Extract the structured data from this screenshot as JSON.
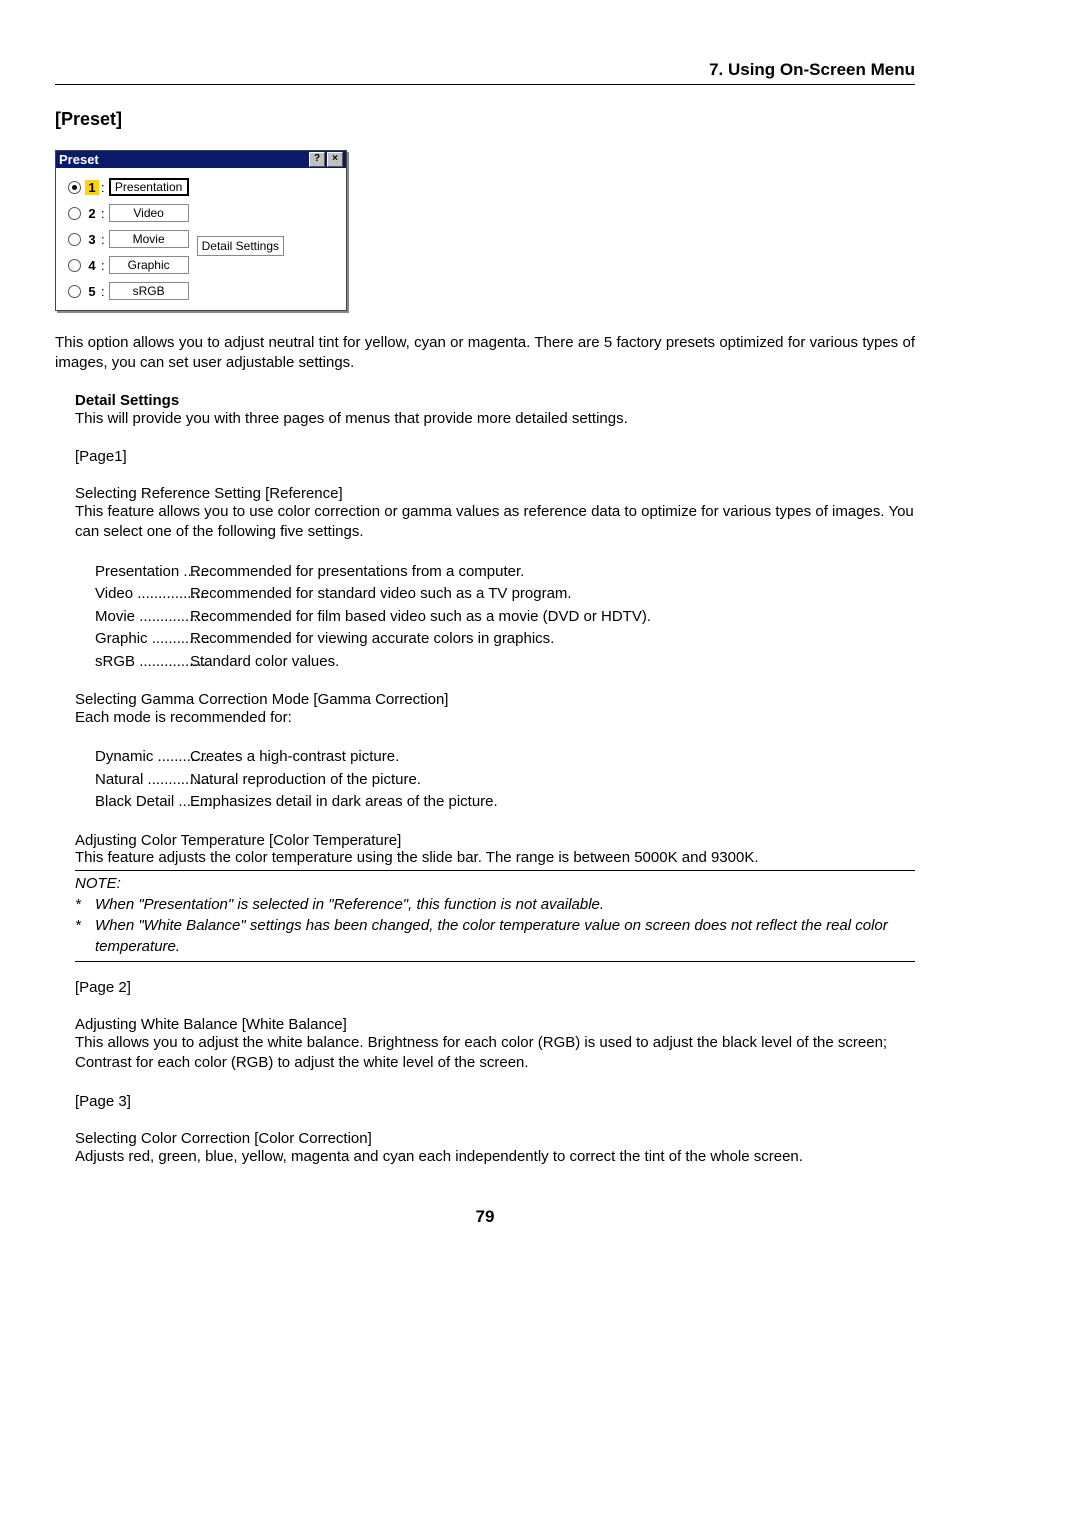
{
  "header": "7. Using On-Screen Menu",
  "section_title": "[Preset]",
  "dialog": {
    "title": "Preset",
    "detail_btn": "Detail Settings",
    "rows": [
      {
        "num": "1",
        "label": "Presentation",
        "checked": true
      },
      {
        "num": "2",
        "label": "Video",
        "checked": false
      },
      {
        "num": "3",
        "label": "Movie",
        "checked": false
      },
      {
        "num": "4",
        "label": "Graphic",
        "checked": false
      },
      {
        "num": "5",
        "label": "sRGB",
        "checked": false
      }
    ]
  },
  "intro": "This option allows you to adjust neutral tint for yellow, cyan or magenta. There are 5 factory presets optimized for various types of images, you can set user adjustable settings.",
  "detail_heading": "Detail Settings",
  "detail_desc": "This will provide you with three pages of menus that provide more detailed settings.",
  "page1_label": "[Page1]",
  "ref_title": "Selecting Reference Setting [Reference]",
  "ref_desc": "This feature allows you to use color correction or gamma values as reference data to optimize for various types of images. You can select one of the following five settings.",
  "ref_list": [
    {
      "term": "Presentation",
      "sep": "......",
      "desc": "Recommended for presentations from a computer."
    },
    {
      "term": "Video",
      "sep": ".................",
      "desc": "Recommended for standard video such as a TV program."
    },
    {
      "term": "Movie",
      "sep": "................",
      "desc": "Recommended for film based video such as a movie (DVD or HDTV)."
    },
    {
      "term": "Graphic",
      "sep": "..............",
      "desc": "Recommended for viewing accurate colors in graphics."
    },
    {
      "term": "sRGB",
      "sep": ".................",
      "desc": "Standard color values."
    }
  ],
  "gamma_title": "Selecting Gamma Correction Mode [Gamma Correction]",
  "gamma_desc": "Each mode is recommended for:",
  "gamma_list": [
    {
      "term": "Dynamic",
      "sep": "............",
      "desc": "Creates a high-contrast picture."
    },
    {
      "term": "Natural",
      "sep": "...............",
      "desc": "Natural reproduction of the picture."
    },
    {
      "term": "Black Detail",
      "sep": "........",
      "desc": "Emphasizes detail in dark areas of the picture."
    }
  ],
  "color_temp_title": "Adjusting Color Temperature [Color Temperature]",
  "color_temp_desc": "This feature adjusts the color temperature using the slide bar. The range is between 5000K and 9300K.",
  "note_label": "NOTE:",
  "note1": "When \"Presentation\" is selected in \"Reference\", this function is not available.",
  "note2": "When \"White Balance\" settings has been changed, the color temperature value on screen does not reflect the real color temperature.",
  "page2_label": "[Page 2]",
  "wb_title": "Adjusting White Balance [White Balance]",
  "wb_desc": "This allows you to adjust the white balance. Brightness for each color (RGB) is used to adjust the black level of the screen; Contrast for each color (RGB) to adjust the white level of the screen.",
  "page3_label": "[Page 3]",
  "cc_title": "Selecting Color Correction [Color Correction]",
  "cc_desc": "Adjusts red, green, blue, yellow, magenta and cyan each independently to correct the tint of the whole screen.",
  "page_num": "79"
}
